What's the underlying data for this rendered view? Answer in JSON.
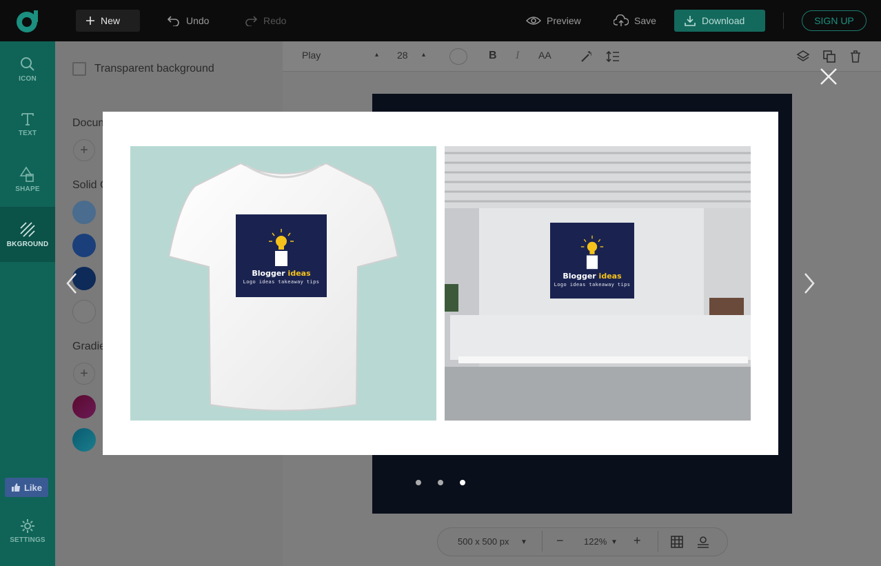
{
  "topbar": {
    "logo_icon": "brand-logo-icon",
    "new_label": "New",
    "undo_label": "Undo",
    "redo_label": "Redo",
    "preview_label": "Preview",
    "save_label": "Save",
    "download_label": "Download",
    "signup_label": "SIGN UP"
  },
  "rail": {
    "items": [
      {
        "label": "ICON",
        "icon": "search-icon"
      },
      {
        "label": "TEXT",
        "icon": "text-icon"
      },
      {
        "label": "SHAPE",
        "icon": "shape-icon"
      },
      {
        "label": "BKGROUND",
        "icon": "background-icon",
        "active": true
      }
    ],
    "like_label": "Like",
    "settings_label": "SETTINGS"
  },
  "panel": {
    "transparent_label": "Transparent background",
    "document_label": "Docum",
    "solid_label": "Solid C",
    "gradient_label": "Gradie"
  },
  "toolbar": {
    "font_name": "Play",
    "font_size": "28",
    "bold": "B",
    "italic": "I",
    "case": "AA"
  },
  "canvas": {
    "size_label": "500 x 500 px",
    "zoom_label": "122%"
  },
  "modal": {
    "slides": [
      {
        "scene": "t-shirt mockup",
        "brand_a": "Blogger ",
        "brand_b": "ideas",
        "tagline": "Logo ideas takeaway tips"
      },
      {
        "scene": "office reception mockup",
        "brand_a": "Blogger ",
        "brand_b": "ideas",
        "tagline": "Logo ideas takeaway tips"
      }
    ],
    "active_dot": 3,
    "dot_count": 3
  },
  "colors": {
    "topbar_bg": "#0c0c0c",
    "rail_bg": "#0f6457",
    "download_bg": "#14695d",
    "logo_card_bg": "#1a2350",
    "accent_yellow": "#f5c21b"
  }
}
